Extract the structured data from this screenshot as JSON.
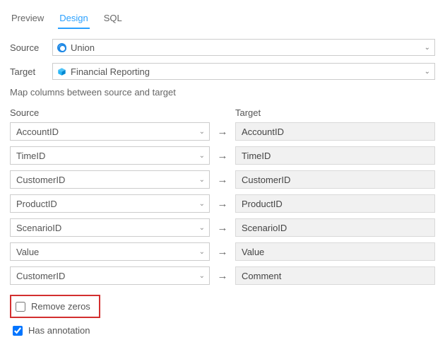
{
  "tabs": {
    "preview": "Preview",
    "design": "Design",
    "sql": "SQL"
  },
  "source_label": "Source",
  "source_value": "Union",
  "target_label": "Target",
  "target_value": "Financial Reporting",
  "instruction": "Map columns between source and target",
  "col_source_label": "Source",
  "col_target_label": "Target",
  "mappings": [
    {
      "src": "AccountID",
      "tgt": "AccountID"
    },
    {
      "src": "TimeID",
      "tgt": "TimeID"
    },
    {
      "src": "CustomerID",
      "tgt": "CustomerID"
    },
    {
      "src": "ProductID",
      "tgt": "ProductID"
    },
    {
      "src": "ScenarioID",
      "tgt": "ScenarioID"
    },
    {
      "src": "Value",
      "tgt": "Value"
    },
    {
      "src": "CustomerID",
      "tgt": "Comment"
    }
  ],
  "chk_remove_zeros": "Remove zeros",
  "chk_has_annotation": "Has annotation"
}
